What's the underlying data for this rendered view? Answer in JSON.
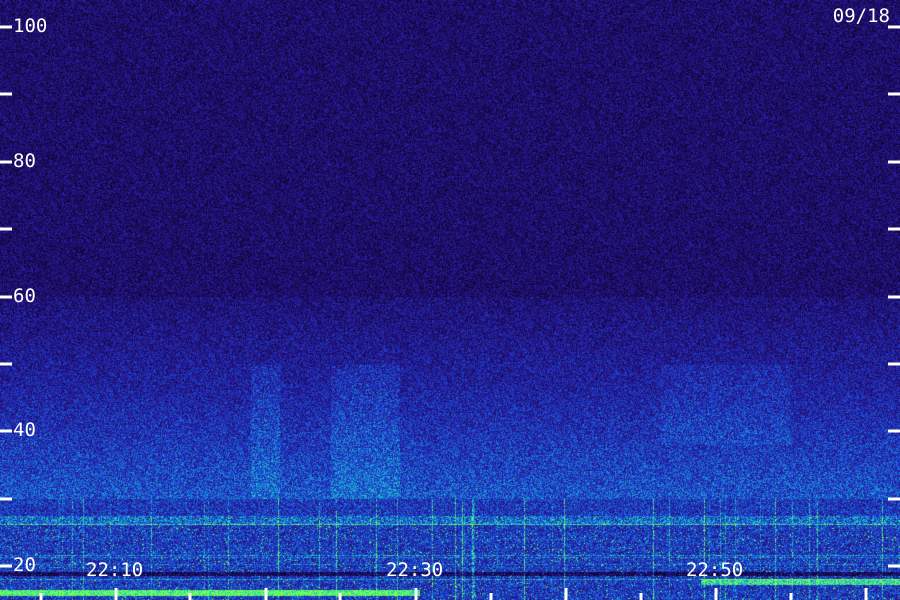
{
  "date_label": "09/18",
  "chart_data": {
    "type": "heatmap",
    "title": "",
    "xlabel": "",
    "ylabel": "",
    "date": "09/18",
    "y_ticks": [
      "100",
      "80",
      "60",
      "40",
      "20"
    ],
    "y_tick_values": [
      100,
      80,
      60,
      40,
      20
    ],
    "ylim": [
      15,
      104
    ],
    "x_ticks": [
      "22:10",
      "22:30",
      "22:50"
    ],
    "x_tick_values_minutes": [
      10,
      30,
      50
    ],
    "xlim_minutes": [
      2.3,
      62.3
    ],
    "minor_y_step": 10,
    "major_x_tick_step_minutes": 10,
    "minor_x_tick_step_minutes": 5,
    "colormap": [
      "#000000",
      "#1a0a5a",
      "#2a1a9a",
      "#1a4ad8",
      "#1aa0d8",
      "#20e0b0",
      "#70ff50"
    ],
    "intensity_notes": {
      "persistent_band_low": [
        20,
        22
      ],
      "bright_line_values": [
        16,
        27
      ],
      "upper_noise_floor": [
        60,
        104
      ]
    }
  }
}
